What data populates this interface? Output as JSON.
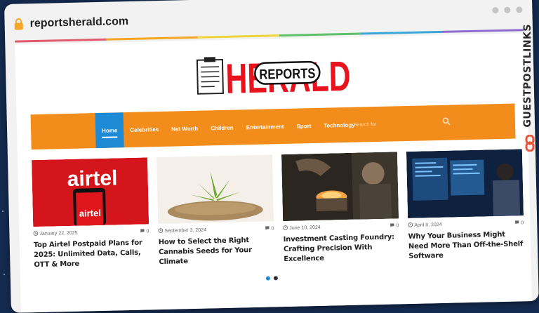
{
  "browser": {
    "url": "reportsherald.com",
    "lock_icon": "lock-icon"
  },
  "brand": {
    "logo_word_main": "HERALD",
    "logo_word_badge": "REPORTS",
    "accent": "#f28c1a",
    "logo_red": "#e8131d",
    "active_blue": "#1e8ad6"
  },
  "nav": {
    "items": [
      {
        "label": "Home",
        "active": true
      },
      {
        "label": "Celebrities"
      },
      {
        "label": "Net Worth"
      },
      {
        "label": "Children"
      },
      {
        "label": "Entertainment"
      },
      {
        "label": "Sport"
      },
      {
        "label": "Technology"
      }
    ],
    "search_placeholder": "Search for"
  },
  "articles": [
    {
      "date": "January 22, 2025",
      "comments": "0",
      "title": "Top Airtel Postpaid Plans for 2025: Unlimited Data, Calls, OTT & More",
      "thumb_text_1": "airtel",
      "thumb_text_2": "airtel"
    },
    {
      "date": "September 3, 2024",
      "comments": "0",
      "title": "How to Select the Right Cannabis Seeds for Your Climate"
    },
    {
      "date": "June 10, 2024",
      "comments": "0",
      "title": "Investment Casting Foundry: Crafting Precision With Excellence"
    },
    {
      "date": "April 8, 2024",
      "comments": "0",
      "title": "Why Your Business Might Need More Than Off-the-Shelf Software"
    }
  ],
  "side_banner": {
    "text": "GUESTPOSTLINKS"
  }
}
